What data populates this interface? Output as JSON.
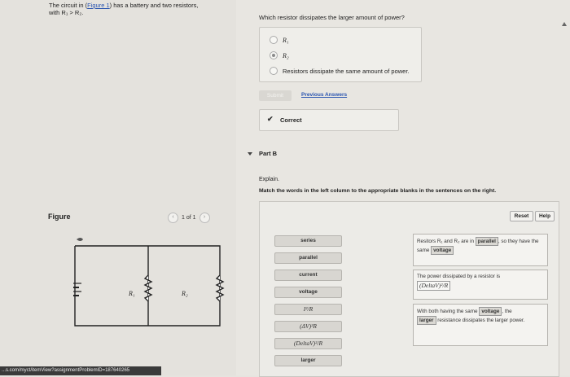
{
  "intro": {
    "text_before": "The circuit in (",
    "figure_link": "Figure 1",
    "text_after": ") has a battery and two resistors,",
    "line2": "with R₁ > R₂."
  },
  "figure": {
    "label": "Figure",
    "pager": "1 of 1",
    "prev_icon": "chevron-left-icon",
    "next_icon": "chevron-right-icon",
    "r1_label": "R₁",
    "r2_label": "R₂"
  },
  "part_a": {
    "question": "Which resistor dissipates the larger amount of power?",
    "options": [
      {
        "label": "R₁",
        "selected": false
      },
      {
        "label": "R₂",
        "selected": true
      },
      {
        "label": "Resistors dissipate the same amount of power.",
        "selected": false
      }
    ],
    "submit_label": "Submit",
    "previous_answers": "Previous Answers",
    "feedback": "Correct"
  },
  "part_b": {
    "title": "Part B",
    "explain": "Explain.",
    "instruction": "Match the words in the left column to the appropriate blanks in the sentences on the right.",
    "reset_label": "Reset",
    "help_label": "Help",
    "tiles": [
      "series",
      "parallel",
      "current",
      "voltage",
      "I²/R",
      "(ΔV)²R",
      "(DeltaV)²/R",
      "larger"
    ],
    "sentences": {
      "s1_a": "Resitors R₁ and R₂ are in",
      "s1_blank1": "parallel",
      "s1_b": ", so they have the same",
      "s1_blank2": "voltage",
      "s2_a": "The power dissipated by a resistor is",
      "s2_blank": "(DeltaV)²/R",
      "s3_a": "With both having the same",
      "s3_blank1": "voltage",
      "s3_b": ", the",
      "s3_blank2": "larger",
      "s3_c": "resistance dissipates the larger power."
    }
  },
  "status_bar": "...s.com/myct/itemView?assignmentProblemID=187640265"
}
